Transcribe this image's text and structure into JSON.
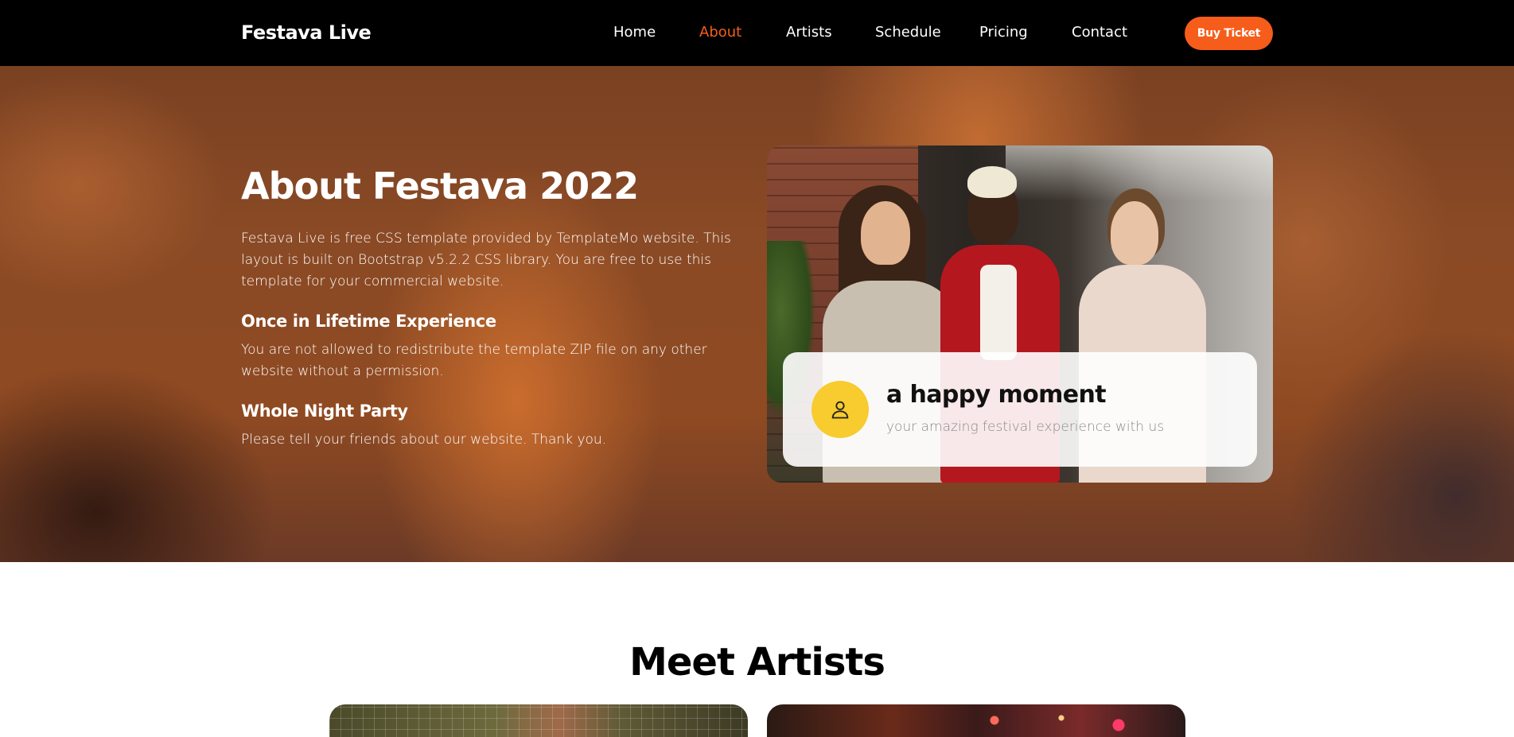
{
  "header": {
    "brand": "Festava Live",
    "nav": [
      {
        "label": "Home",
        "active": false
      },
      {
        "label": "About",
        "active": true
      },
      {
        "label": "Artists",
        "active": false
      },
      {
        "label": "Schedule",
        "active": false
      },
      {
        "label": "Pricing",
        "active": false
      },
      {
        "label": "Contact",
        "active": false
      }
    ],
    "cta_label": "Buy Ticket"
  },
  "about": {
    "title": "About Festava 2022",
    "intro": "Festava Live is free CSS template provided by TemplateMo website. This layout is built on Bootstrap v5.2.2 CSS library. You are free to use this template for your commercial website.",
    "subsections": [
      {
        "heading": "Once in Lifetime Experience",
        "text": "You are not allowed to redistribute the template ZIP file on any other website without a permission."
      },
      {
        "heading": "Whole Night Party",
        "text": "Please tell your friends about our website. Thank you."
      }
    ],
    "card": {
      "title": "a happy moment",
      "subtitle": "your amazing festival experience with us",
      "avatar_icon": "person-icon"
    }
  },
  "artists": {
    "title": "Meet Artists"
  },
  "colors": {
    "accent": "#f65d1b",
    "avatar_bg": "#f8cb2e",
    "nav_bg": "#000000"
  }
}
